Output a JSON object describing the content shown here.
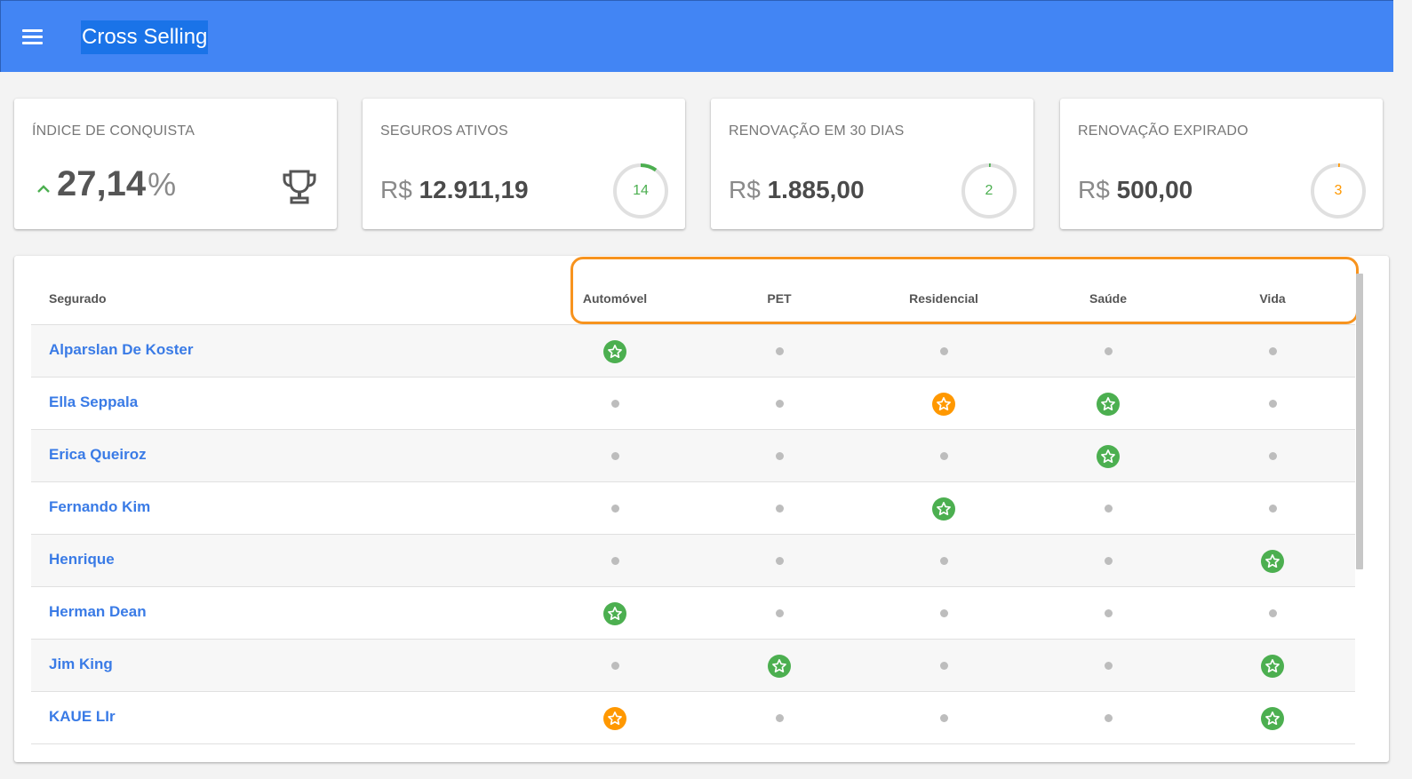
{
  "app": {
    "title": "Cross Selling"
  },
  "theme": {
    "primary": "#4285f4",
    "success": "#4caf50",
    "warning": "#ff9800",
    "link": "#3a7be6",
    "highlight": "#f7931e"
  },
  "cards": [
    {
      "title": "ÍNDICE DE CONQUISTA",
      "value": "27,14",
      "unit": "%",
      "trend": "up",
      "icon": "trophy-icon"
    },
    {
      "title": "SEGUROS ATIVOS",
      "currency": "R$",
      "value": "12.911,19",
      "count": "14",
      "progress": 0.1,
      "ring_color": "#4caf50"
    },
    {
      "title": "RENOVAÇÃO EM 30 DIAS",
      "currency": "R$",
      "value": "1.885,00",
      "count": "2",
      "progress": 0.01,
      "ring_color": "#4caf50"
    },
    {
      "title": "RENOVAÇÃO EXPIRADO",
      "currency": "R$",
      "value": "500,00",
      "count": "3",
      "progress": 0.01,
      "ring_color": "#ff9800"
    }
  ],
  "table": {
    "columns": [
      "Segurado",
      "Automóvel",
      "PET",
      "Residencial",
      "Saúde",
      "Vida"
    ],
    "rows": [
      {
        "name": "Alparslan De Koster",
        "cells": [
          "green",
          "none",
          "none",
          "none",
          "none"
        ]
      },
      {
        "name": "Ella Seppala",
        "cells": [
          "none",
          "none",
          "orange",
          "green",
          "none"
        ]
      },
      {
        "name": "Erica Queiroz",
        "cells": [
          "none",
          "none",
          "none",
          "green",
          "none"
        ]
      },
      {
        "name": "Fernando Kim",
        "cells": [
          "none",
          "none",
          "green",
          "none",
          "none"
        ]
      },
      {
        "name": "Henrique",
        "cells": [
          "none",
          "none",
          "none",
          "none",
          "green"
        ]
      },
      {
        "name": "Herman Dean",
        "cells": [
          "green",
          "none",
          "none",
          "none",
          "none"
        ]
      },
      {
        "name": "Jim King",
        "cells": [
          "none",
          "green",
          "none",
          "none",
          "green"
        ]
      },
      {
        "name": "KAUE LIr",
        "cells": [
          "orange",
          "none",
          "none",
          "none",
          "green"
        ]
      }
    ]
  }
}
